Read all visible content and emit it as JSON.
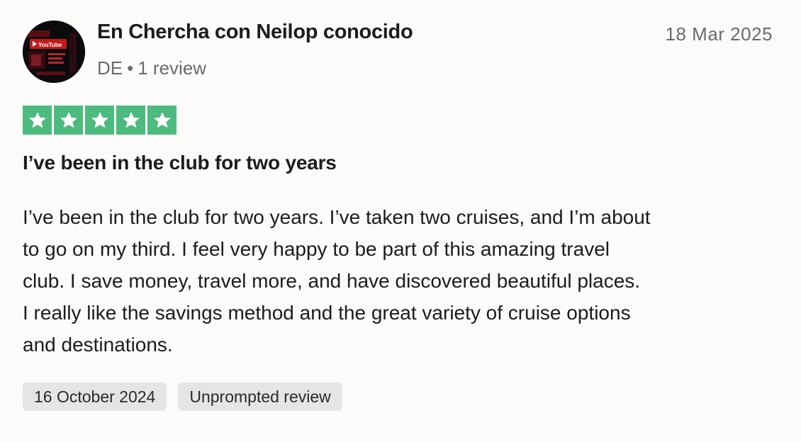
{
  "reviewer": {
    "name": "En Chercha con Neilop conocido",
    "country": "DE",
    "separator": "•",
    "review_count": "1 review",
    "avatar_text": "YouTube"
  },
  "review": {
    "date": "18 Mar 2025",
    "rating": 5,
    "rating_max": 5,
    "star_color": "#4dbb7f",
    "title": "I’ve been in the club for two years",
    "body_lines": [
      "I’ve been in the club for two years. I’ve taken two cruises, and I’m about",
      "to go on my third. I feel very happy to be part of this amazing travel",
      "club. I save money, travel more, and have discovered beautiful places.",
      "I really like the savings method and the great variety of cruise options",
      "and destinations."
    ]
  },
  "tags": {
    "experience_date": "16 October 2024",
    "review_type": "Unprompted review"
  }
}
